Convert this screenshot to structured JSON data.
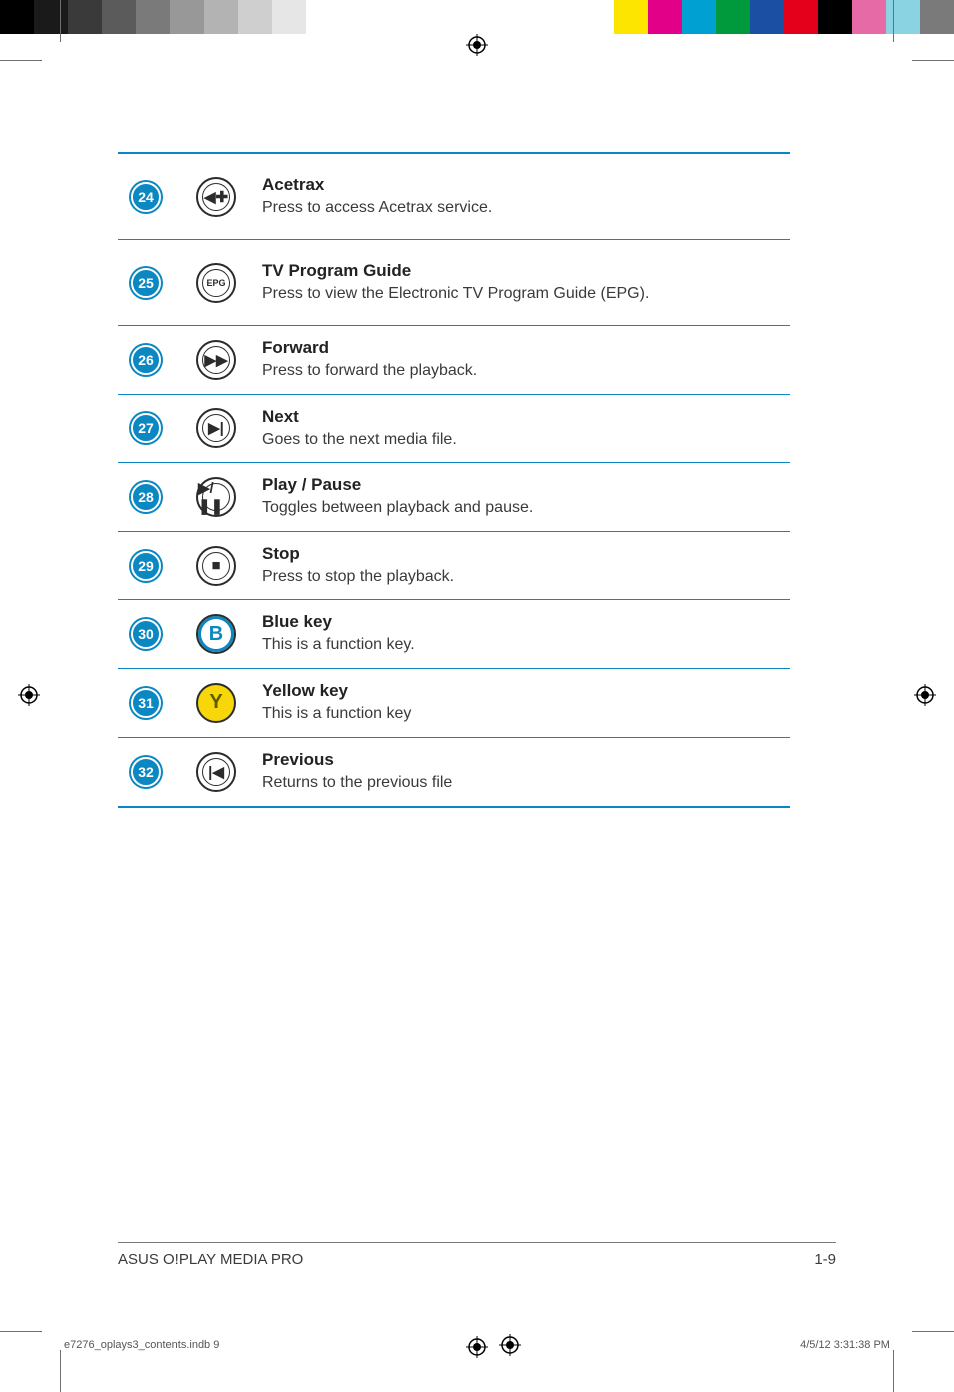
{
  "colorbar_left": [
    "#000000",
    "#1a1a1a",
    "#3a3a3a",
    "#5b5b5b",
    "#7a7a7a",
    "#989898",
    "#b3b3b3",
    "#cfcfcf",
    "#e6e6e6",
    "#ffffff"
  ],
  "colorbar_right": [
    "#ffffff",
    "#fde500",
    "#e10087",
    "#00a0d2",
    "#009a3d",
    "#1a4fa3",
    "#e4001b",
    "#000000",
    "#e66aa6",
    "#8ad3e2",
    "#7a7a7a"
  ],
  "rows": [
    {
      "num": "24",
      "icon": "acetrax-icon",
      "icon_glyph": "◀✚",
      "title": "Acetrax",
      "desc": "Press to access Acetrax service.",
      "height": "h-tall"
    },
    {
      "num": "25",
      "icon": "epg-icon",
      "icon_glyph": "EPG",
      "title": "TV Program Guide",
      "desc": " Press to view the Electronic TV Program Guide (EPG).",
      "height": "h-tall"
    },
    {
      "num": "26",
      "icon": "forward-icon",
      "icon_glyph": "▶▶",
      "title": "Forward",
      "desc": "Press to forward the playback.",
      "height": "h-med"
    },
    {
      "num": "27",
      "icon": "next-icon",
      "icon_glyph": "▶|",
      "title": "Next",
      "desc": "Goes to the next media file.",
      "height": "h-short"
    },
    {
      "num": "28",
      "icon": "play-pause-icon",
      "icon_glyph": "▶/❚❚",
      "title": "Play / Pause",
      "desc": "Toggles between playback and pause.",
      "height": "h-short"
    },
    {
      "num": "29",
      "icon": "stop-icon",
      "icon_glyph": "■",
      "title": "Stop",
      "desc": "Press to stop the playback.",
      "height": "h-short"
    },
    {
      "num": "30",
      "icon": "blue-key-icon",
      "icon_glyph": "B",
      "title": "Blue key",
      "desc": "This is a function key.",
      "height": "h-med"
    },
    {
      "num": "31",
      "icon": "yellow-key-icon",
      "icon_glyph": "Y",
      "title": "Yellow key",
      "desc": "This is a function key",
      "height": "h-med"
    },
    {
      "num": "32",
      "icon": "previous-icon",
      "icon_glyph": "|◀",
      "title": "Previous",
      "desc": "Returns to the previous file",
      "height": "h-med"
    }
  ],
  "footer": {
    "left": "ASUS O!PLAY MEDIA PRO",
    "right": "1-9"
  },
  "print_meta": {
    "left": "e7276_oplays3_contents.indb   9",
    "right": "4/5/12   3:31:38 PM"
  }
}
